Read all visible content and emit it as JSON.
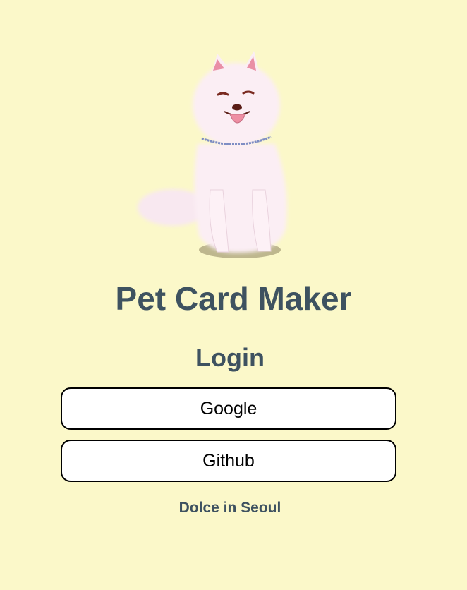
{
  "header": {
    "title": "Pet Card Maker",
    "image": "samoyed-dog-illustration"
  },
  "login": {
    "title": "Login",
    "google_label": "Google",
    "github_label": "Github"
  },
  "footer": {
    "text": "Dolce in Seoul"
  },
  "colors": {
    "background": "#fbf8c9",
    "text": "#3e5260",
    "button_bg": "#ffffff",
    "button_border": "#000000"
  }
}
